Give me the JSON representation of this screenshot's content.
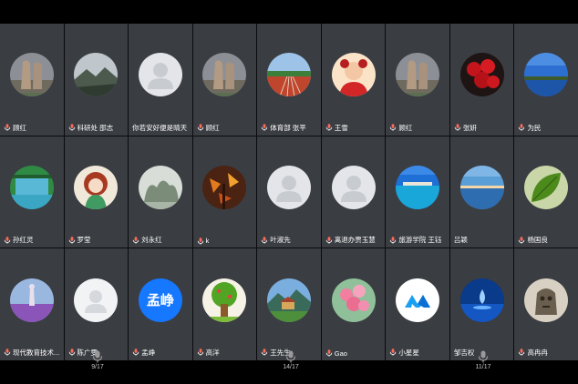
{
  "participants": [
    {
      "name": "顾红",
      "avatar": "rocks-photo"
    },
    {
      "name": "科研处 邵志",
      "avatar": "mountain-photo"
    },
    {
      "name": "你若安好便是晴天",
      "avatar": "default-person",
      "nomic": true
    },
    {
      "name": "顾红",
      "avatar": "rocks-photo"
    },
    {
      "name": "体育部 张平",
      "avatar": "track-photo"
    },
    {
      "name": "王雪",
      "avatar": "child-photo"
    },
    {
      "name": "顾红",
      "avatar": "rocks-photo"
    },
    {
      "name": "张妍",
      "avatar": "roses-photo"
    },
    {
      "name": "为民",
      "avatar": "lake-photo"
    },
    {
      "name": "孙红灵",
      "avatar": "waterfall-photo"
    },
    {
      "name": "罗莹",
      "avatar": "cartoon-girl"
    },
    {
      "name": "刘永红",
      "avatar": "mist-photo"
    },
    {
      "name": "k",
      "avatar": "autumn-photo"
    },
    {
      "name": "叶淑先",
      "avatar": "default-person"
    },
    {
      "name": "离退办贾玉慧",
      "avatar": "default-person"
    },
    {
      "name": "旅游学院 王钰",
      "avatar": "maldives-photo"
    },
    {
      "name": "吕颖",
      "avatar": "sunset-photo",
      "nomic": true
    },
    {
      "name": "杨国良",
      "avatar": "leaf-photo"
    },
    {
      "name": "现代教育技术...",
      "avatar": "purple-field-photo"
    },
    {
      "name": "陈广雯",
      "avatar": "default-person-light"
    },
    {
      "name": "孟峥",
      "avatar": "text",
      "avatar_text": "孟峥"
    },
    {
      "name": "高洋",
      "avatar": "cartoon-tree"
    },
    {
      "name": "王先生",
      "avatar": "scenic-photo"
    },
    {
      "name": "Gao",
      "avatar": "flowers-photo"
    },
    {
      "name": "小星星",
      "avatar": "app-logo"
    },
    {
      "name": "邹吉权",
      "avatar": "water-drop-photo",
      "nomic": true
    },
    {
      "name": "高冉冉",
      "avatar": "stone-statue"
    }
  ],
  "pager_indicators": [
    {
      "label": "9/17"
    },
    {
      "label": "14/17"
    },
    {
      "label": "11/17"
    }
  ],
  "colors": {
    "tile_bg": "#3a3d42",
    "mic": "#ff6a5c",
    "text_avatar": "#1677ff"
  }
}
